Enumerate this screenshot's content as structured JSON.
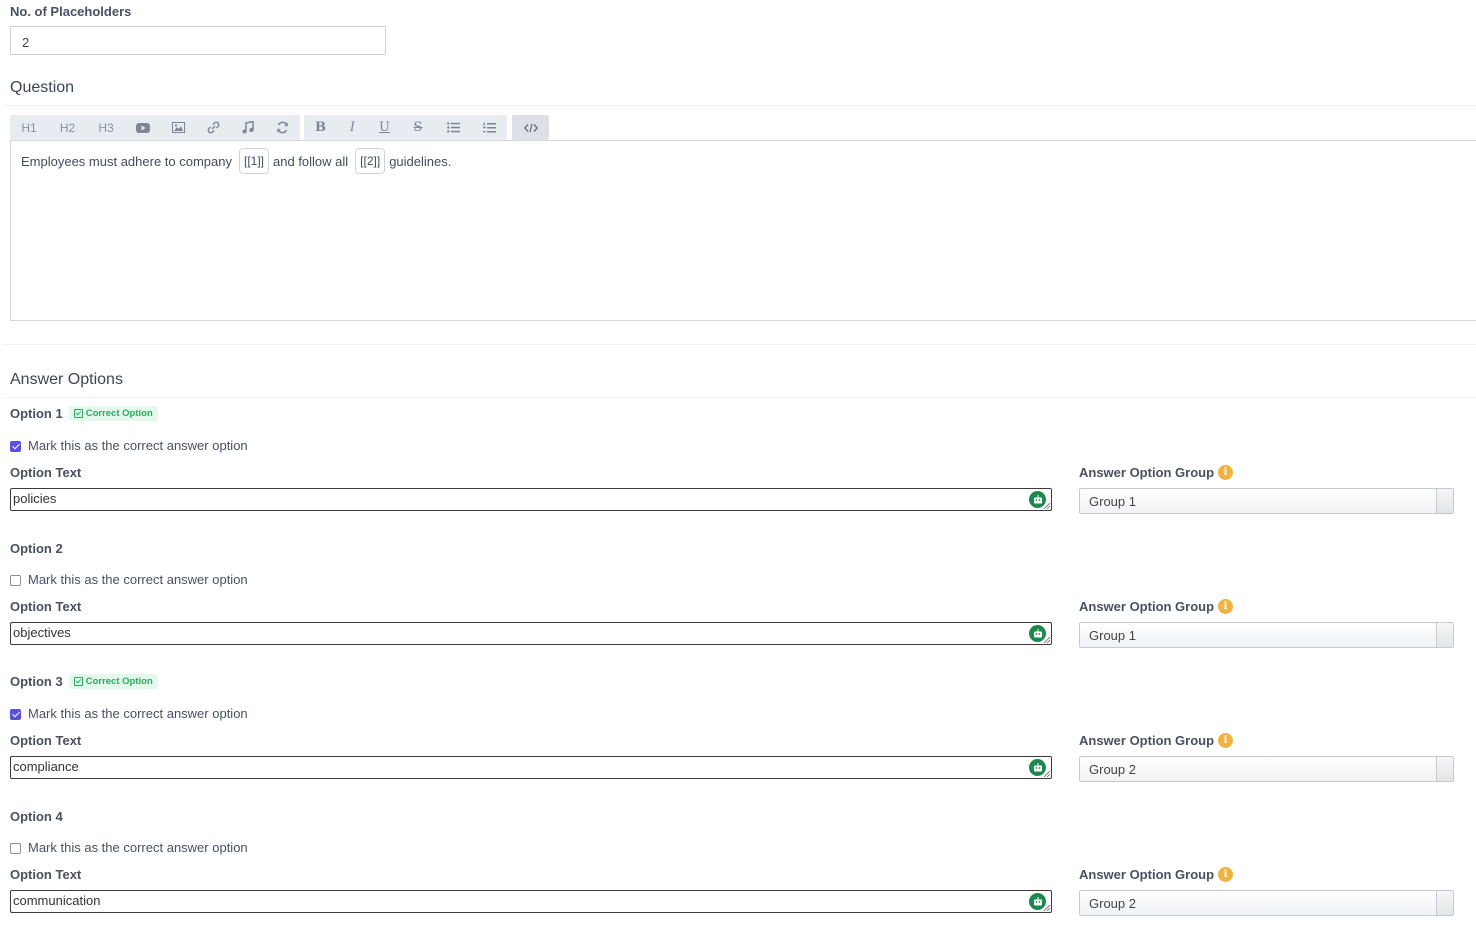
{
  "placeholders": {
    "label": "No. of Placeholders",
    "value": "2"
  },
  "question": {
    "heading": "Question",
    "toolbar": {
      "headings": [
        "H1",
        "H2",
        "H3"
      ],
      "media_icons": [
        "video-icon",
        "image-icon",
        "link-icon",
        "music-icon",
        "refresh-icon"
      ],
      "format_icons": [
        "bold-icon",
        "italic-icon",
        "underline-icon",
        "strikethrough-icon",
        "bullet-list-icon",
        "numbered-list-icon"
      ],
      "code_icon": "code-icon"
    },
    "editor": {
      "part1": "Employees must adhere to company",
      "placeholder1": "[[1]]",
      "part2": "and follow all",
      "placeholder2": "[[2]]",
      "part3": "guidelines."
    }
  },
  "answer_options": {
    "heading": "Answer Options",
    "correct_badge": "Correct Option",
    "checkbox_label": "Mark this as the correct answer option",
    "option_text_label": "Option Text",
    "group_label": "Answer Option Group",
    "options": [
      {
        "title": "Option 1",
        "correct": true,
        "text": "policies",
        "group": "Group 1"
      },
      {
        "title": "Option 2",
        "correct": false,
        "text": "objectives",
        "group": "Group 1"
      },
      {
        "title": "Option 3",
        "correct": true,
        "text": "compliance",
        "group": "Group 2"
      },
      {
        "title": "Option 4",
        "correct": false,
        "text": "communication",
        "group": "Group 2"
      }
    ]
  },
  "colors": {
    "accent": "#5c4ee0",
    "correct_green": "#2daa5f",
    "robot_green": "#1c8a4c",
    "info_orange": "#f0b342"
  }
}
